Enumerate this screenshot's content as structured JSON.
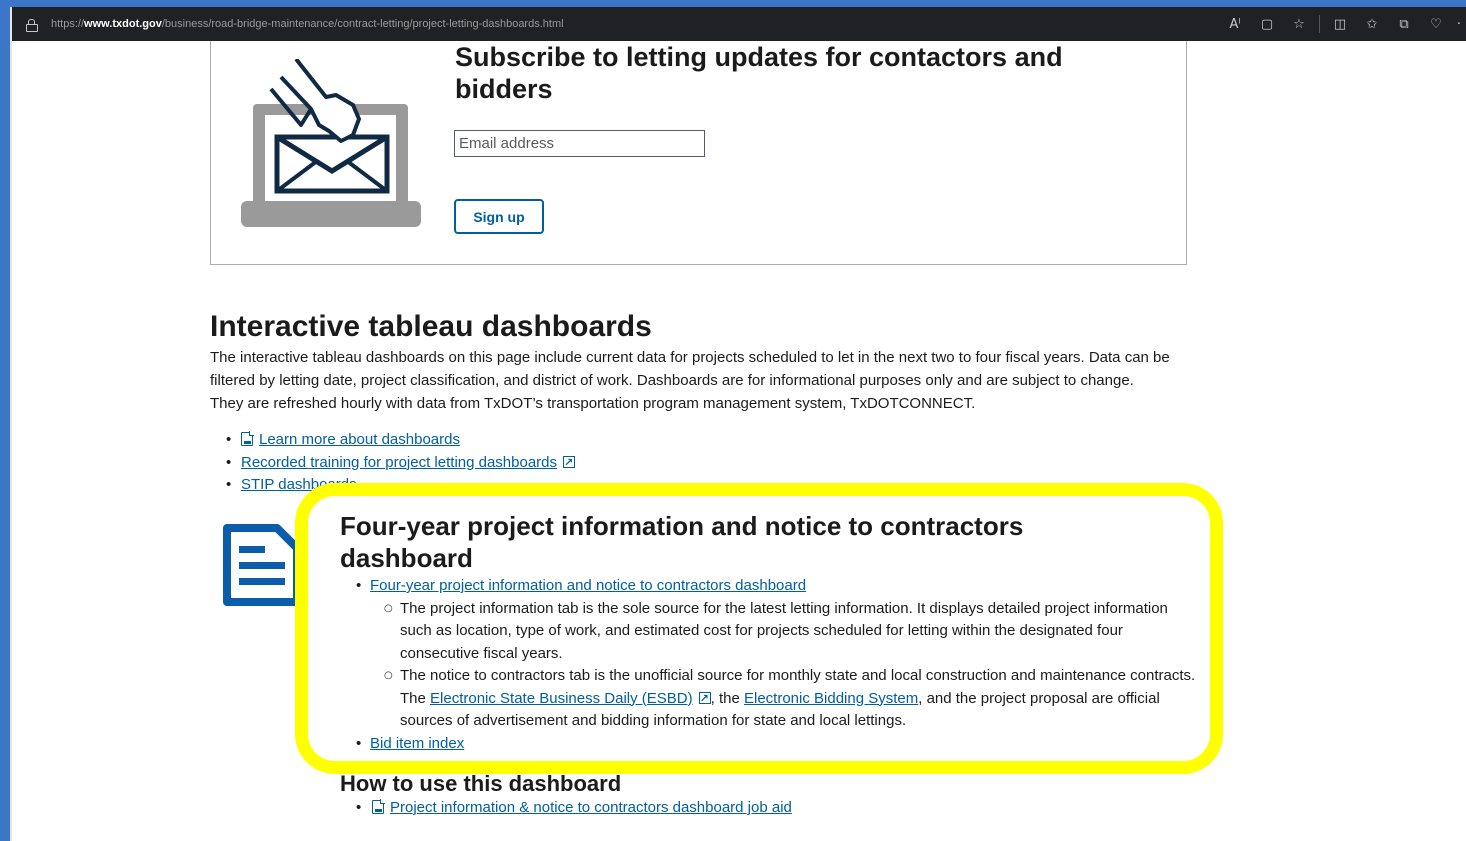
{
  "browser": {
    "url_proto": "https://",
    "url_host": "www.txdot.gov",
    "url_path": "/business/road-bridge-maintenance/contract-letting/project-letting-dashboards.html",
    "read_aloud_icon": "Aˡ"
  },
  "subscribe": {
    "title": "Subscribe to letting updates for contactors and bidders",
    "email_placeholder": "Email address",
    "signup_label": "Sign up"
  },
  "dashboards": {
    "title": "Interactive tableau dashboards",
    "description": "The interactive tableau dashboards on this page include current data for projects scheduled to let in the next two to four fiscal years. Data can be filtered by letting date, project classification, and district of work. Dashboards are for informational purposes only and are subject to change. They are refreshed hourly with data from TxDOT’s transportation program management system, TxDOTCONNECT.",
    "links": {
      "learn_more": "Learn more about dashboards",
      "recorded_training": "Recorded training for project letting dashboards",
      "stip": "STIP dashboards"
    }
  },
  "four_year": {
    "title": "Four-year project information and notice to contractors dashboard",
    "dashboard_link": "Four-year project information and notice to contractors dashboard",
    "project_info_text": "The project information tab is the sole source for the latest letting information. It displays detailed project information such as location, type of work, and estimated cost for projects scheduled for letting within the designated four consecutive fiscal years.",
    "notice_text_1": "The notice to contractors tab is the unofficial source for monthly state and local construction and maintenance contracts. The ",
    "esbd_link": "Electronic State Business Daily (ESBD)",
    "notice_text_2": ", the ",
    "ebs_link": "Electronic Bidding System",
    "notice_text_3": ", and the project proposal are official sources of advertisement and bidding information for state and local lettings.",
    "bid_item_link": "Bid item index"
  },
  "howto": {
    "title": "How to use this dashboard",
    "job_aid_link": "Project information & notice to contractors dashboard job aid"
  },
  "colors": {
    "link": "#005ea2",
    "highlight": "#ffff00",
    "icon_blue": "#0b5cab",
    "laptop_gray": "#9a9a9a",
    "envelope_navy": "#102a43"
  }
}
